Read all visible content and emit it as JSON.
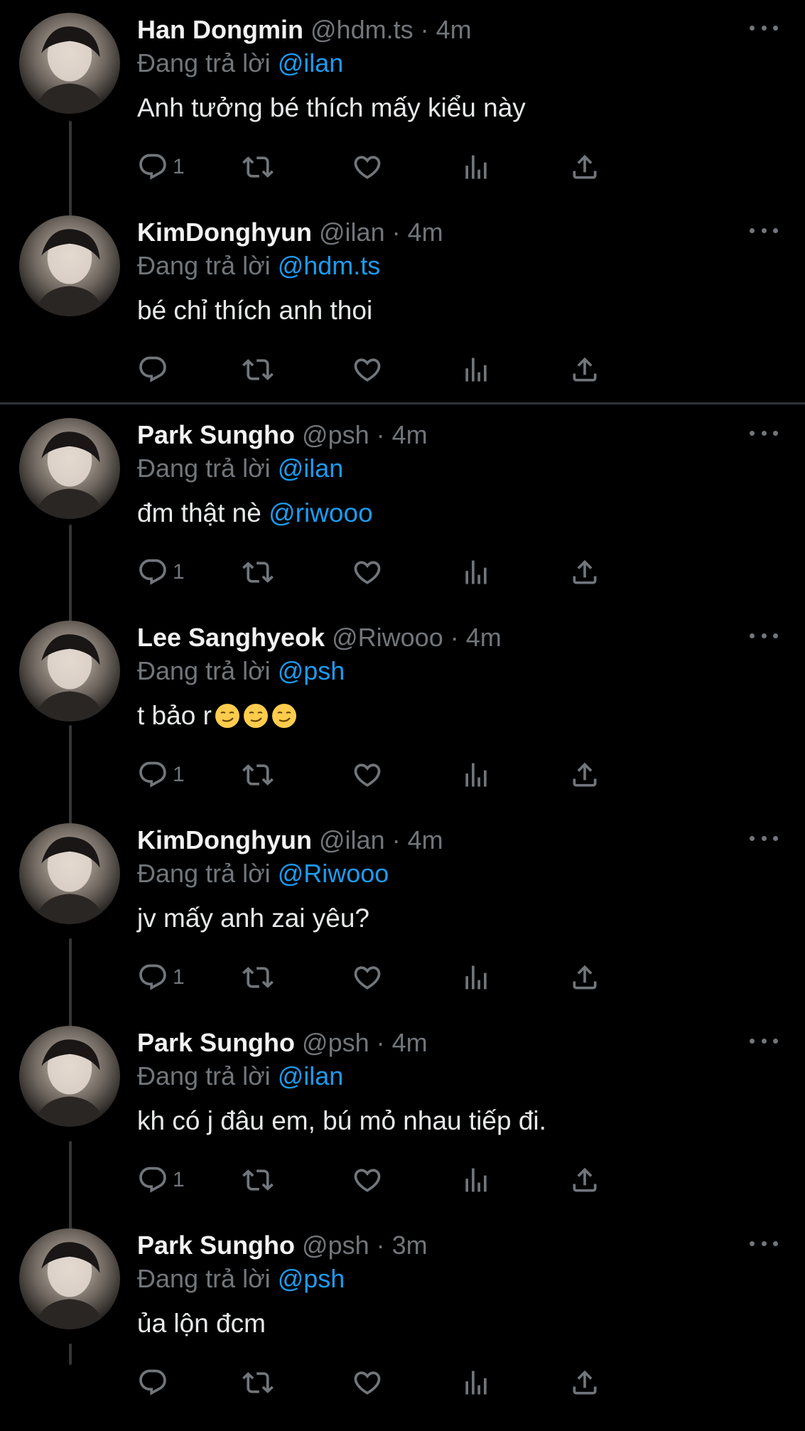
{
  "labels": {
    "replying_prefix": "Đang trả lời"
  },
  "colors": {
    "background": "#000000",
    "mention": "#1d9bf0",
    "muted": "#71767b",
    "thread_line": "#333639"
  },
  "tweets": [
    {
      "name": "Han Dongmin",
      "handle": "@hdm.ts",
      "time": "4m",
      "reply_to": "@ilan",
      "text": "Anh tưởng bé thích mấy kiểu này",
      "text_mention": "",
      "reply_count": "1",
      "avatar": "avatar-photo"
    },
    {
      "name": "KimDonghyun",
      "handle": "@ilan",
      "time": "4m",
      "reply_to": "@hdm.ts",
      "text": "bé chỉ thích anh thoi",
      "text_mention": "",
      "reply_count": "",
      "avatar": "avatar-photo"
    },
    {
      "name": "Park Sungho",
      "handle": "@psh",
      "time": "4m",
      "reply_to": "@ilan",
      "text": "đm thật nè ",
      "text_mention": "@riwooo",
      "reply_count": "1",
      "avatar": "avatar-photo"
    },
    {
      "name": "Lee Sanghyeok",
      "handle": "@Riwooo",
      "time": "4m",
      "reply_to": "@psh",
      "text": "t bảo r",
      "text_mention": "",
      "emojis": [
        "smirk-emoji",
        "smirk-emoji",
        "smirk-emoji"
      ],
      "reply_count": "1",
      "avatar": "avatar-photo"
    },
    {
      "name": "KimDonghyun",
      "handle": "@ilan",
      "time": "4m",
      "reply_to": "@Riwooo",
      "text": "jv mấy anh zai yêu?",
      "text_mention": "",
      "reply_count": "1",
      "avatar": "avatar-photo"
    },
    {
      "name": "Park Sungho",
      "handle": "@psh",
      "time": "4m",
      "reply_to": "@ilan",
      "text": "kh có j đâu em, bú mỏ nhau tiếp đi.",
      "text_mention": "",
      "reply_count": "1",
      "avatar": "avatar-photo"
    },
    {
      "name": "Park Sungho",
      "handle": "@psh",
      "time": "3m",
      "reply_to": "@psh",
      "text": "ủa lộn đcm",
      "text_mention": "",
      "reply_count": "",
      "avatar": "avatar-photo"
    }
  ],
  "icons": {
    "reply": "reply-icon",
    "retweet": "retweet-icon",
    "like": "heart-icon",
    "views": "views-icon",
    "share": "share-icon",
    "more": "more-icon"
  }
}
